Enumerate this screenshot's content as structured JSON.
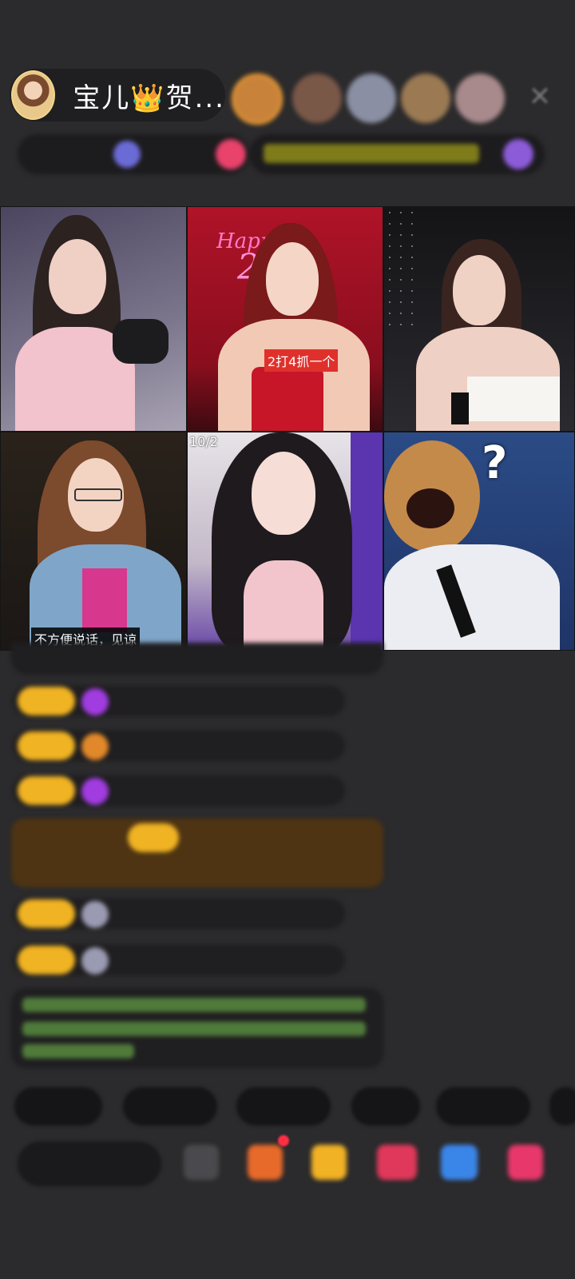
{
  "host": {
    "name": "宝儿👑贺..."
  },
  "close_icon": "close-icon",
  "tiles": [
    {
      "name": "streamer-1"
    },
    {
      "name": "streamer-2",
      "tag": "2打4抓一个"
    },
    {
      "name": "streamer-3"
    },
    {
      "name": "streamer-4",
      "tag": "不方便说话，见谅"
    },
    {
      "name": "streamer-5",
      "count": "10/2"
    },
    {
      "name": "streamer-6",
      "emoji": "?"
    }
  ],
  "colors": {
    "background": "#2b2a2c",
    "badge": "#f0b323",
    "tag_red": "#e0302c"
  }
}
